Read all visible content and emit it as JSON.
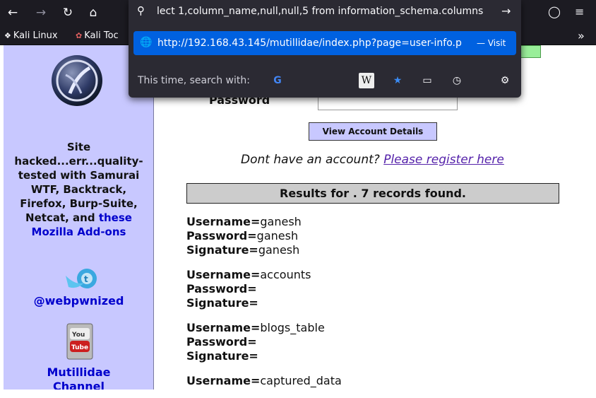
{
  "url_bar": {
    "typed_text": "lect 1,column_name,null,null,5 from information_schema.columns",
    "suggestion_url": "http://192.168.43.145/mutillidae/index.php?page=user-info.p",
    "suggestion_action": "— Visit",
    "search_with_label": "This time, search with:"
  },
  "bookmarks": [
    {
      "label": "Kali Linux"
    },
    {
      "label": "Kali Toc"
    }
  ],
  "sidebar": {
    "hacked_lines": [
      "Site",
      "hacked...err...quality-",
      "tested with Samurai",
      "WTF, Backtrack,",
      "Firefox, Burp-Suite,",
      "Netcat, and"
    ],
    "hacked_link_part1": "these",
    "hacked_link_part2": "Mozilla Add-ons",
    "twitter_link": "@webpwnized",
    "channel_line1": "Mutillidae",
    "channel_line2": "Channel"
  },
  "form": {
    "password_label": "Password",
    "view_button": "View Account Details",
    "register_prompt": "Dont have an account?",
    "register_link": "Please register here"
  },
  "results_header": "Results for . 7 records found.",
  "records": [
    {
      "username": "ganesh",
      "password": "ganesh",
      "signature": "ganesh"
    },
    {
      "username": "accounts",
      "password": "",
      "signature": ""
    },
    {
      "username": "blogs_table",
      "password": "",
      "signature": ""
    },
    {
      "username": "captured_data",
      "password": "",
      "signature": ""
    }
  ],
  "field_labels": {
    "username": "Username=",
    "password": "Password=",
    "signature": "Signature="
  },
  "colors": {
    "sidebar_bg": "#c8c8ff",
    "link": "#0000cc",
    "suggest_bg": "#0061e0"
  }
}
